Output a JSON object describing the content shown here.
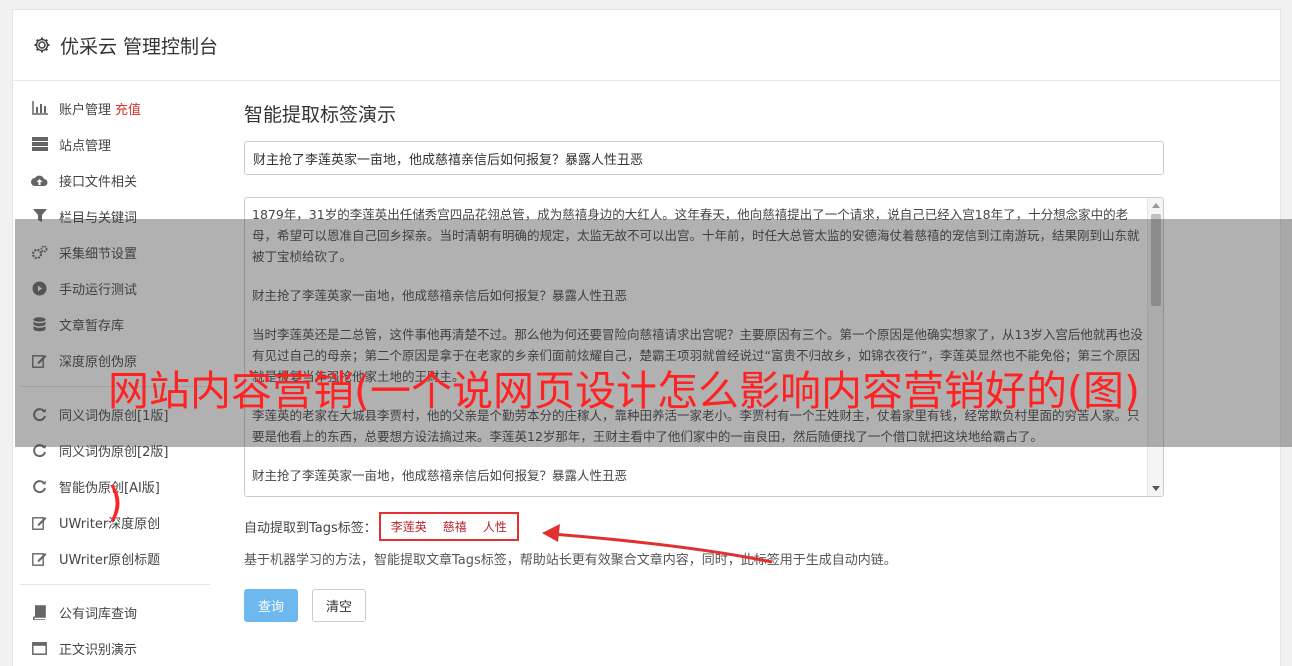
{
  "header": {
    "title": "优采云 管理控制台",
    "icon": "gear-icon"
  },
  "sidebar": {
    "items": [
      {
        "label": "账户管理",
        "badge": "充值",
        "icon": "bar-chart-icon"
      },
      {
        "label": "站点管理",
        "icon": "server-icon"
      },
      {
        "label": "接口文件相关",
        "icon": "cloud-upload-icon"
      },
      {
        "label": "栏目与关键词",
        "icon": "filter-icon"
      },
      {
        "label": "采集细节设置",
        "icon": "gears-icon"
      },
      {
        "label": "手动运行测试",
        "icon": "play-circle-icon"
      },
      {
        "label": "文章暂存库",
        "icon": "database-icon"
      },
      {
        "label": "深度原创伪原",
        "icon": "edit-icon"
      }
    ],
    "items2": [
      {
        "label": "同义词伪原创[1版]",
        "icon": "refresh-icon"
      },
      {
        "label": "同义词伪原创[2版]",
        "icon": "refresh-icon"
      },
      {
        "label": "智能伪原创[AI版]",
        "icon": "refresh-icon"
      },
      {
        "label": "UWriter深度原创",
        "icon": "edit-icon"
      },
      {
        "label": "UWriter原创标题",
        "icon": "edit-icon"
      }
    ],
    "items3": [
      {
        "label": "公有词库查询",
        "icon": "book-icon"
      },
      {
        "label": "正文识别演示",
        "icon": "window-icon"
      }
    ]
  },
  "main": {
    "heading": "智能提取标签演示",
    "title_value": "财主抢了李莲英家一亩地，他成慈禧亲信后如何报复？暴露人性丑恶",
    "article_paragraphs": [
      "1879年，31岁的李莲英出任储秀宫四品花翎总管，成为慈禧身边的大红人。这年春天，他向慈禧提出了一个请求，说自己已经入宫18年了，十分想念家中的老母，希望可以恩准自己回乡探亲。当时清朝有明确的规定，太监无故不可以出宫。十年前，时任大总管太监的安德海仗着慈禧的宠信到江南游玩，结果刚到山东就被丁宝桢给砍了。",
      "财主抢了李莲英家一亩地，他成慈禧亲信后如何报复？暴露人性丑恶",
      "当时李莲英还是二总管，这件事他再清楚不过。那么他为何还要冒险向慈禧请求出宫呢？主要原因有三个。第一个原因是他确实想家了，从13岁入宫后他就再也没有见过自己的母亲；第二个原因是拿于在老家的乡亲们面前炫耀自己，楚霸王项羽就曾经说过“富贵不归故乡，如锦衣夜行”，李莲英显然也不能免俗；第三个原因就是报复当年强抢他家土地的王财主。",
      "李莲英的老家在大城县李贾村，他的父亲是个勤劳本分的庄稼人，靠种田养活一家老小。李贾村有一个王姓财主，仗着家里有钱，经常欺负村里面的穷苦人家。只要是他看上的东西，总要想方设法搞过来。李莲英12岁那年，王财主看中了他们家中的一亩良田，然后随便找了一个借口就把这块地给霸占了。",
      "财主抢了李莲英家一亩地，他成慈禧亲信后如何报复？暴露人性丑恶"
    ],
    "tags_label": "自动提取到Tags标签：",
    "tags": [
      "李莲英",
      "慈禧",
      "人性"
    ],
    "description": "基于机器学习的方法，智能提取文章Tags标签，帮助站长更有效聚合文章内容，同时，此标签用于生成自动内链。",
    "query_button": "查询",
    "clear_button": "清空"
  },
  "overlay": {
    "headline": "网站内容营销(一个说网页设计怎么影响内容营销好的(图)",
    "headline_tail": ")"
  },
  "colors": {
    "accent": "#6cb8ef",
    "highlight": "#e03030",
    "badge": "#d9302c"
  }
}
